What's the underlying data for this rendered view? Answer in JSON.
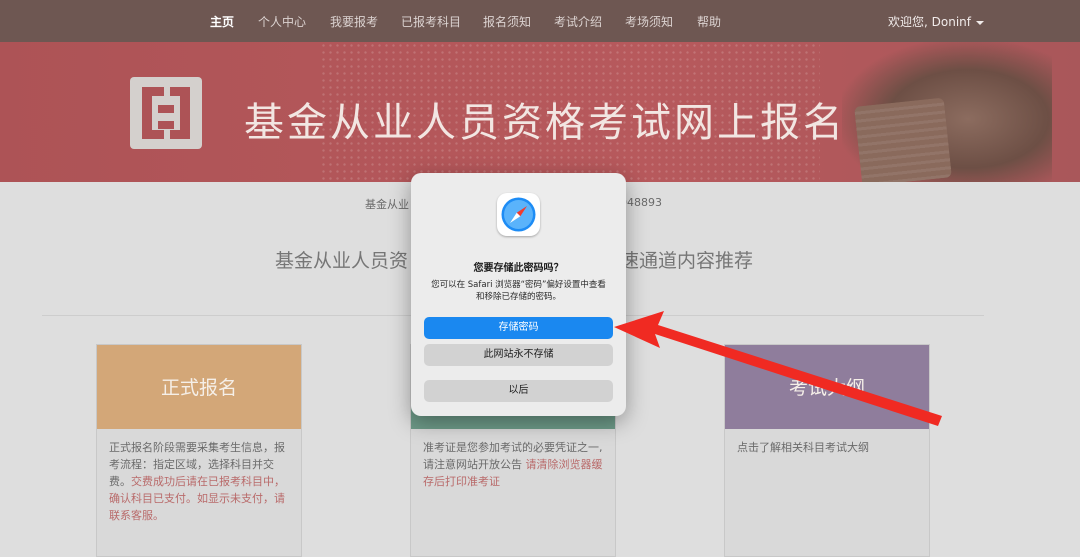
{
  "nav": {
    "items": [
      "主页",
      "个人中心",
      "我要报考",
      "已报考科目",
      "报名须知",
      "考试介绍",
      "考场须知",
      "帮助"
    ],
    "welcome": "欢迎您,  Doninf"
  },
  "banner": {
    "title": "基金从业人员资格考试网上报名"
  },
  "notice": {
    "left": "基金从业",
    "right": "048893"
  },
  "headline": {
    "left": "基金从业人员资",
    "right": "速通道内容推荐"
  },
  "cards": [
    {
      "title": "正式报名",
      "text": "正式报名阶段需要采集考生信息，报考流程：指定区域，选择科目并交费。",
      "red": "交费成功后请在已报考科目中，确认科目已支付。如显示未支付，请联系客服。",
      "color": "#d3a778"
    },
    {
      "title": "",
      "text": "准考证是您参加考试的必要凭证之一,请注意网站开放公告",
      "red": "请清除浏览器缓存后打印准考证",
      "color": "#6d9a88"
    },
    {
      "title": "考试大纲",
      "text": "点击了解相关科目考试大纲",
      "red": "",
      "color": "#8f7d9c"
    }
  ],
  "dialog": {
    "title": "您要存储此密码吗？",
    "message": "您可以在 Safari 浏览器“密码”偏好设置中查看和移除已存储的密码。",
    "save_button": "存储密码",
    "never_button": "此网站永不存储",
    "later_button": "以后"
  },
  "colors": {
    "nav_bg": "#6e5752",
    "banner_bg": "#b25659",
    "primary_button": "#1a88f0",
    "arrow": "#f02a22"
  },
  "icons": {
    "app_icon": "safari-icon",
    "annotation": "red-arrow-icon"
  }
}
